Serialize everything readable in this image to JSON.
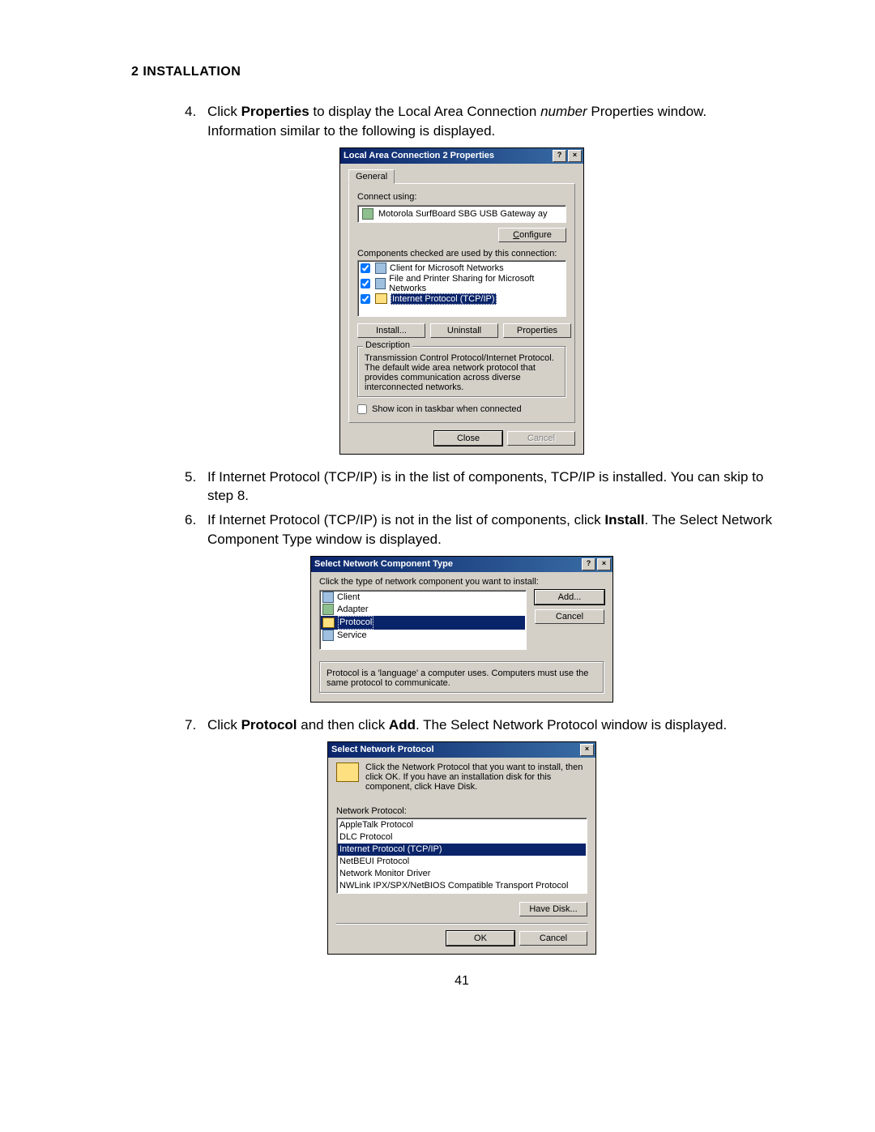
{
  "heading": "2 INSTALLATION",
  "steps": {
    "s4": {
      "num": "4.",
      "pre": "Click ",
      "bold1": "Properties",
      "mid": " to display the Local Area Connection ",
      "italic1": "number",
      "post": " Properties window. Information similar to the following is displayed."
    },
    "s5": {
      "num": "5.",
      "text": "If Internet Protocol (TCP/IP) is in the list of components, TCP/IP is installed. You can skip to step 8."
    },
    "s6": {
      "num": "6.",
      "pre": "If Internet Protocol (TCP/IP) is not in the list of components, click ",
      "bold1": "Install",
      "post": ". The Select Network Component Type window is displayed."
    },
    "s7": {
      "num": "7.",
      "pre": "Click ",
      "bold1": "Protocol",
      "mid": " and then click ",
      "bold2": "Add",
      "post": ". The Select Network Protocol window is displayed."
    }
  },
  "dlg1": {
    "title": "Local Area Connection 2 Properties",
    "tab": "General",
    "connect_using_label": "Connect using:",
    "adapter": "Motorola SurfBoard SBG USB Gateway    ay",
    "configure": "Configure",
    "components_label": "Components checked are used by this connection:",
    "items": [
      {
        "label": "Client for Microsoft Networks",
        "checked": true
      },
      {
        "label": "File and Printer Sharing for Microsoft Networks",
        "checked": true
      },
      {
        "label": "Internet Protocol (TCP/IP)",
        "checked": true,
        "selected": true
      }
    ],
    "install": "Install...",
    "uninstall": "Uninstall",
    "properties": "Properties",
    "desc_label": "Description",
    "desc_text": "Transmission Control Protocol/Internet Protocol. The default wide area network protocol that provides communication across diverse interconnected networks.",
    "show_icon": "Show icon in taskbar when connected",
    "close": "Close",
    "cancel": "Cancel"
  },
  "dlg2": {
    "title": "Select Network Component Type",
    "instruction": "Click the type of network component you want to install:",
    "items": [
      {
        "label": "Client"
      },
      {
        "label": "Adapter"
      },
      {
        "label": "Protocol",
        "selected": true
      },
      {
        "label": "Service"
      }
    ],
    "add": "Add...",
    "cancel": "Cancel",
    "desc": "Protocol is a 'language' a computer uses. Computers must use the same protocol to communicate."
  },
  "dlg3": {
    "title": "Select Network Protocol",
    "instruction": "Click the Network Protocol that you want to install, then click OK. If you have an installation disk for this component, click Have Disk.",
    "list_label": "Network Protocol:",
    "items": [
      {
        "label": "AppleTalk Protocol"
      },
      {
        "label": "DLC Protocol"
      },
      {
        "label": "Internet Protocol (TCP/IP)",
        "selected": true
      },
      {
        "label": "NetBEUI Protocol"
      },
      {
        "label": "Network Monitor Driver"
      },
      {
        "label": "NWLink IPX/SPX/NetBIOS Compatible Transport Protocol"
      }
    ],
    "have_disk": "Have Disk...",
    "ok": "OK",
    "cancel": "Cancel"
  },
  "page_number": "41"
}
